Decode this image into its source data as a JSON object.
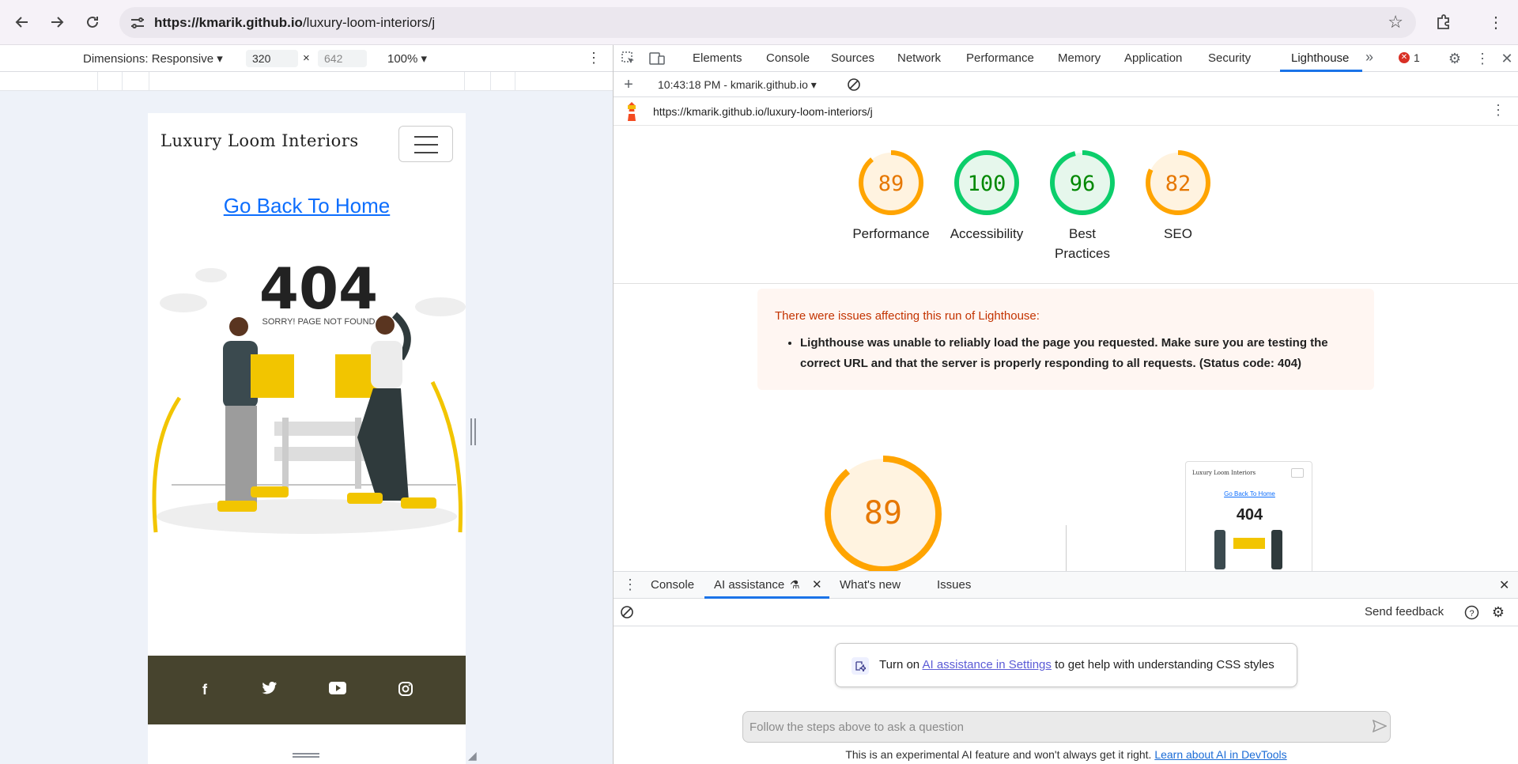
{
  "browser": {
    "url_domain": "https://kmarik.github.io",
    "url_path": "/luxury-loom-interiors/j"
  },
  "device_toolbar": {
    "dimensions_label": "Dimensions: Responsive ▾",
    "width_value": "320",
    "times": "×",
    "height_value": "642",
    "zoom": "100% ▾"
  },
  "site": {
    "brand": "Luxury Loom Interiors",
    "home_link": "Go Back To Home",
    "error_code": "404",
    "error_text": "SORRY! PAGE NOT FOUND",
    "social_icons": [
      "facebook-icon",
      "twitter-icon",
      "youtube-icon",
      "instagram-icon"
    ]
  },
  "devtools": {
    "tabs": [
      "Elements",
      "Console",
      "Sources",
      "Network",
      "Performance",
      "Memory",
      "Application",
      "Security",
      "Lighthouse"
    ],
    "active_tab": "Lighthouse",
    "error_count": "1",
    "run_label": "10:43:18 PM - kmarik.github.io ▾",
    "report_url": "https://kmarik.github.io/luxury-loom-interiors/j"
  },
  "lighthouse": {
    "scores": [
      {
        "label": "Performance",
        "value": "89",
        "color": "#e67700",
        "ring": "#ffa400",
        "bg": "#fff3e0",
        "fraction": 0.89
      },
      {
        "label": "Accessibility",
        "value": "100",
        "color": "#008800",
        "ring": "#0cce6b",
        "bg": "#e6f7ec",
        "fraction": 1.0
      },
      {
        "label": "Best Practices",
        "value": "96",
        "color": "#008800",
        "ring": "#0cce6b",
        "bg": "#e6f7ec",
        "fraction": 0.96
      },
      {
        "label": "SEO",
        "value": "82",
        "color": "#e67700",
        "ring": "#ffa400",
        "bg": "#fff3e0",
        "fraction": 0.82
      }
    ],
    "warning_title": "There were issues affecting this run of Lighthouse:",
    "warning_item": "Lighthouse was unable to reliably load the page you requested. Make sure you are testing the correct URL and that the server is properly responding to all requests. (Status code: 404)",
    "big_score": "89",
    "big_fraction": 0.89,
    "thumb_brand": "Luxury Loom Interiors",
    "thumb_link": "Go Back To Home",
    "thumb_404": "404"
  },
  "drawer": {
    "tabs": [
      "Console",
      "AI assistance",
      "What's new",
      "Issues"
    ],
    "active_tab": "AI assistance",
    "send_feedback": "Send feedback",
    "ai_prefix": "Turn on ",
    "ai_link": "AI assistance in Settings",
    "ai_suffix": " to get help with understanding CSS styles",
    "ask_placeholder": "Follow the steps above to ask a question",
    "footnote_text": "This is an experimental AI feature and won't always get it right. ",
    "footnote_link": "Learn about AI in DevTools"
  }
}
